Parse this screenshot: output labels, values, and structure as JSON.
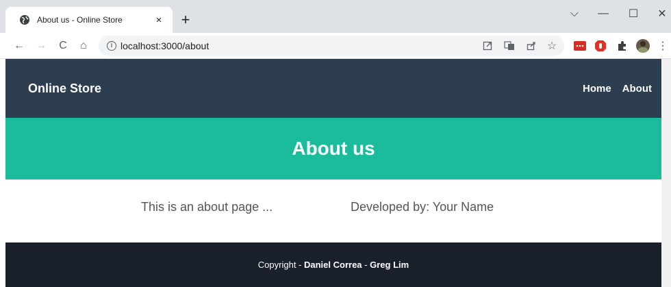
{
  "browser": {
    "tab_title": "About us - Online Store",
    "tab_close": "×",
    "new_tab": "+",
    "url": "localhost:3000/about",
    "window_controls": {
      "dropdown": "⌵",
      "minimize": "—",
      "maximize": "☐",
      "close": "✕"
    },
    "nav": {
      "back": "←",
      "forward": "→",
      "reload": "C",
      "home": "⌂"
    },
    "menu": "⋮"
  },
  "site": {
    "brand": "Online Store",
    "nav_links": [
      "Home",
      "About"
    ],
    "hero_title": "About us",
    "about_text": "This is an about page ...",
    "developed_by": "Developed by: Your Name",
    "footer": {
      "prefix": "Copyright - ",
      "author1": "Daniel Correa",
      "sep": " - ",
      "author2": "Greg Lim"
    }
  },
  "colors": {
    "navbar": "#2c3e50",
    "hero": "#1abc9c",
    "footer": "#1a202c"
  }
}
